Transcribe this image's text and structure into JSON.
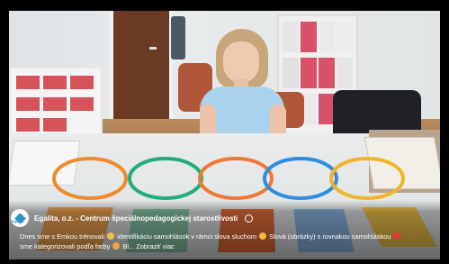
{
  "channel": {
    "name": "Egalita, o.z. - Centrum špeciálnopedagogickej starostlivosti",
    "logo_text": "Egalita"
  },
  "description": {
    "line1_a": "Dnes sme s Emkou trénovali",
    "line1_b": "identifikáciu samohlások v rámci slova sluchom",
    "line1_c": "Slová (obrázky) s rovnakou samohláskou",
    "line2_a": "sme kategorizovali podľa farby",
    "line2_b": "Bl...",
    "more": "Zobraziť viac"
  },
  "colors": {
    "ring_colors": [
      "#f08a2a",
      "#1fae7a",
      "#f07836",
      "#2f8de0",
      "#f0b62a"
    ],
    "card_colors": [
      "#f2a452",
      "#8bc8a8",
      "#e96e3a",
      "#8cb9e4",
      "#f3c44a"
    ]
  },
  "icons": [
    "flexed-biceps-emoji-icon",
    "ear-emoji-icon",
    "no-entry-emoji-icon",
    "pencil-emoji-icon",
    "verified-icon"
  ]
}
